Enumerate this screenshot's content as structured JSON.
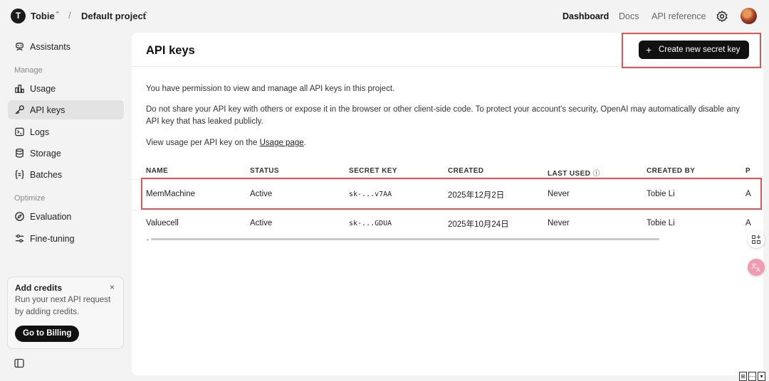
{
  "topbar": {
    "org_initial": "T",
    "org_name": "Tobie",
    "separator": "/",
    "project_name": "Default project",
    "nav": [
      "Dashboard",
      "Docs",
      "API reference"
    ],
    "icons": [
      "chevron-updown-icon",
      "gear-icon"
    ]
  },
  "sidebar": {
    "item_assistants": "Assistants",
    "section_manage": "Manage",
    "manage_items": [
      "Usage",
      "API keys",
      "Logs",
      "Storage",
      "Batches"
    ],
    "section_optimize": "Optimize",
    "optimize_items": [
      "Evaluation",
      "Fine-tuning"
    ],
    "active_item": "API keys",
    "credits": {
      "title": "Add credits",
      "close": "×",
      "text": "Run your next API request by adding credits.",
      "button": "Go to Billing"
    }
  },
  "main": {
    "title": "API keys",
    "create_button": "Create new secret key",
    "create_icon": "+",
    "permission_text": "You have permission to view and manage all API keys in this project.",
    "warning_text": "Do not share your API key with others or expose it in the browser or other client-side code. To protect your account's security, OpenAI may automatically disable any API key that has leaked publicly.",
    "usage_text_prefix": "View usage per API key on the ",
    "usage_link": "Usage page",
    "usage_text_suffix": ".",
    "table": {
      "headers": [
        "NAME",
        "STATUS",
        "SECRET KEY",
        "CREATED",
        "LAST USED",
        "CREATED BY",
        "P"
      ],
      "last_used_info_icon": "ⓘ",
      "rows": [
        {
          "name": "MemMachine",
          "status": "Active",
          "key": "sk-...v7AA",
          "created": "2025年12月2日",
          "last_used": "Never",
          "created_by": "Tobie Li",
          "perm": "A"
        },
        {
          "name": "Valuecell",
          "status": "Active",
          "key": "sk-...GDUA",
          "created": "2025年10月24日",
          "last_used": "Never",
          "created_by": "Tobie Li",
          "perm": "A"
        }
      ]
    }
  },
  "colors": {
    "highlight": "#e05555",
    "button_bg": "#111111",
    "active_item_bg": "#e3e3e3"
  }
}
